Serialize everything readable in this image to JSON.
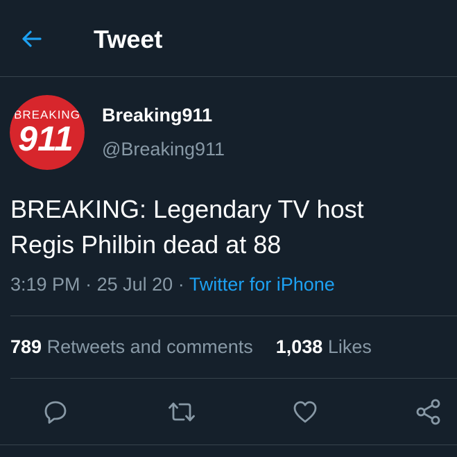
{
  "header": {
    "title": "Tweet",
    "back_icon": "arrow-left-icon"
  },
  "author": {
    "avatar_text_top": "BREAKING",
    "avatar_text_number": "911",
    "display_name": "Breaking911",
    "handle": "@Breaking911"
  },
  "tweet": {
    "text_line1": "BREAKING: Legendary TV host",
    "text_line2": "Regis Philbin dead at 88",
    "time": "3:19 PM",
    "separator": "·",
    "date": "25 Jul 20",
    "source": "Twitter for iPhone"
  },
  "stats": {
    "retweets_count": "789",
    "retweets_label": "Retweets and comments",
    "likes_count": "1,038",
    "likes_label": "Likes"
  },
  "actions": [
    {
      "icon": "reply-icon"
    },
    {
      "icon": "retweet-icon"
    },
    {
      "icon": "heart-icon"
    },
    {
      "icon": "share-icon"
    }
  ],
  "colors": {
    "background": "#15202b",
    "accent": "#1da1f2",
    "secondary_text": "#8899a6",
    "border": "#38444d",
    "avatar_red": "#d7262c"
  }
}
